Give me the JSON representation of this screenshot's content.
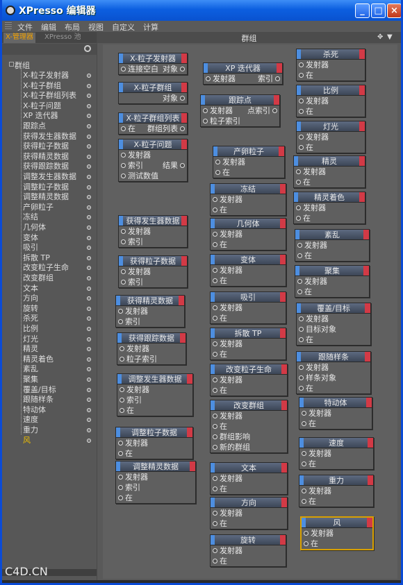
{
  "window": {
    "title": "XPresso 编辑器",
    "buttons": {
      "minimize": "_",
      "maximize": "□",
      "close": "×"
    }
  },
  "menu": [
    "文件",
    "编辑",
    "布局",
    "视图",
    "自定义",
    "计算"
  ],
  "left_panel": {
    "tabs": [
      "X-管理器",
      "XPresso 池"
    ],
    "root": "群组",
    "items": [
      "X-粒子发射器",
      "X-粒子群组",
      "X-粒子群组列表",
      "X-粒子问题",
      "XP 迭代器",
      "跟踪点",
      "获得发生器数据",
      "获得粒子数据",
      "获得精灵数据",
      "获得跟踪数据",
      "调整发生器数据",
      "调整粒子数据",
      "调整精灵数据",
      "产卵粒子",
      "冻结",
      "几何体",
      "变体",
      "吸引",
      "拆散 TP",
      "改变粒子生命",
      "改变群组",
      "文本",
      "方向",
      "旋转",
      "杀死",
      "比例",
      "灯光",
      "精灵",
      "精灵着色",
      "紊乱",
      "聚集",
      "覆盖/目标",
      "跟随样条",
      "特动体",
      "速度",
      "重力",
      "风"
    ],
    "selected_index": 36
  },
  "main_panel": {
    "title": "群组",
    "nodes": [
      {
        "title": "X-粒子发射器",
        "rows": [
          [
            "连接空白",
            "对象"
          ]
        ]
      },
      {
        "title": "X-粒子群组",
        "rows": [
          [
            "",
            "对象"
          ]
        ]
      },
      {
        "title": "X-粒子群组列表",
        "rows": [
          [
            "在",
            "群组列表"
          ]
        ]
      },
      {
        "title": "X-粒子问题",
        "rows": [
          [
            "发射器",
            ""
          ],
          [
            "索引",
            "结果"
          ],
          [
            "测试数值",
            ""
          ]
        ]
      },
      {
        "title": "获得发生器数据",
        "rows": [
          [
            "发射器",
            ""
          ],
          [
            "索引",
            ""
          ]
        ]
      },
      {
        "title": "获得粒子数据",
        "rows": [
          [
            "发射器",
            ""
          ],
          [
            "索引",
            ""
          ]
        ]
      },
      {
        "title": "获得精灵数据",
        "rows": [
          [
            "发射器",
            ""
          ],
          [
            "索引",
            ""
          ]
        ]
      },
      {
        "title": "获得跟踪数据",
        "rows": [
          [
            "发射器",
            ""
          ],
          [
            "粒子索引",
            ""
          ]
        ]
      },
      {
        "title": "调整发生器数据",
        "rows": [
          [
            "发射器",
            ""
          ],
          [
            "索引",
            ""
          ],
          [
            "在",
            ""
          ]
        ]
      },
      {
        "title": "调整粒子数据",
        "rows": [
          [
            "发射器",
            ""
          ],
          [
            "在",
            ""
          ]
        ]
      },
      {
        "title": "调整精灵数据",
        "rows": [
          [
            "发射器",
            ""
          ],
          [
            "索引",
            ""
          ],
          [
            "在",
            ""
          ]
        ]
      },
      {
        "title": "XP 迭代器",
        "rows": [
          [
            "发射器",
            "索引"
          ]
        ]
      },
      {
        "title": "跟踪点",
        "rows": [
          [
            "发射器",
            "点索引"
          ],
          [
            "粒子索引",
            ""
          ]
        ]
      },
      {
        "title": "产卵粒子",
        "rows": [
          [
            "发射器",
            ""
          ],
          [
            "在",
            ""
          ]
        ]
      },
      {
        "title": "冻结",
        "rows": [
          [
            "发射器",
            ""
          ],
          [
            "在",
            ""
          ]
        ]
      },
      {
        "title": "几何体",
        "rows": [
          [
            "发射器",
            ""
          ],
          [
            "在",
            ""
          ]
        ]
      },
      {
        "title": "变体",
        "rows": [
          [
            "发射器",
            ""
          ],
          [
            "在",
            ""
          ]
        ]
      },
      {
        "title": "吸引",
        "rows": [
          [
            "发射器",
            ""
          ],
          [
            "在",
            ""
          ]
        ]
      },
      {
        "title": "拆散 TP",
        "rows": [
          [
            "发射器",
            ""
          ],
          [
            "在",
            ""
          ]
        ]
      },
      {
        "title": "改变粒子生命",
        "rows": [
          [
            "发射器",
            ""
          ],
          [
            "在",
            ""
          ]
        ]
      },
      {
        "title": "改变群组",
        "rows": [
          [
            "发射器",
            ""
          ],
          [
            "在",
            ""
          ],
          [
            "群组影响",
            ""
          ],
          [
            "新的群组",
            ""
          ]
        ]
      },
      {
        "title": "文本",
        "rows": [
          [
            "发射器",
            ""
          ],
          [
            "在",
            ""
          ]
        ]
      },
      {
        "title": "方向",
        "rows": [
          [
            "发射器",
            ""
          ],
          [
            "在",
            ""
          ]
        ]
      },
      {
        "title": "旋转",
        "rows": [
          [
            "发射器",
            ""
          ],
          [
            "在",
            ""
          ]
        ]
      },
      {
        "title": "杀死",
        "rows": [
          [
            "发射器",
            ""
          ],
          [
            "在",
            ""
          ]
        ]
      },
      {
        "title": "比例",
        "rows": [
          [
            "发射器",
            ""
          ],
          [
            "在",
            ""
          ]
        ]
      },
      {
        "title": "灯光",
        "rows": [
          [
            "发射器",
            ""
          ],
          [
            "在",
            ""
          ]
        ]
      },
      {
        "title": "精灵",
        "rows": [
          [
            "发射器",
            ""
          ],
          [
            "在",
            ""
          ]
        ]
      },
      {
        "title": "精灵着色",
        "rows": [
          [
            "发射器",
            ""
          ],
          [
            "在",
            ""
          ]
        ]
      },
      {
        "title": "紊乱",
        "rows": [
          [
            "发射器",
            ""
          ],
          [
            "在",
            ""
          ]
        ]
      },
      {
        "title": "聚集",
        "rows": [
          [
            "发射器",
            ""
          ],
          [
            "在",
            ""
          ]
        ]
      },
      {
        "title": "覆盖/目标",
        "rows": [
          [
            "发射器",
            ""
          ],
          [
            "目标对象",
            ""
          ],
          [
            "在",
            ""
          ]
        ]
      },
      {
        "title": "跟随样条",
        "rows": [
          [
            "发射器",
            ""
          ],
          [
            "样条对象",
            ""
          ],
          [
            "在",
            ""
          ]
        ]
      },
      {
        "title": "特动体",
        "rows": [
          [
            "发射器",
            ""
          ],
          [
            "在",
            ""
          ]
        ]
      },
      {
        "title": "速度",
        "rows": [
          [
            "发射器",
            ""
          ],
          [
            "在",
            ""
          ]
        ]
      },
      {
        "title": "重力",
        "rows": [
          [
            "发射器",
            ""
          ],
          [
            "在",
            ""
          ]
        ]
      },
      {
        "title": "风",
        "rows": [
          [
            "发射器",
            ""
          ],
          [
            "在",
            ""
          ]
        ]
      }
    ]
  },
  "watermark": "C4D.CN"
}
